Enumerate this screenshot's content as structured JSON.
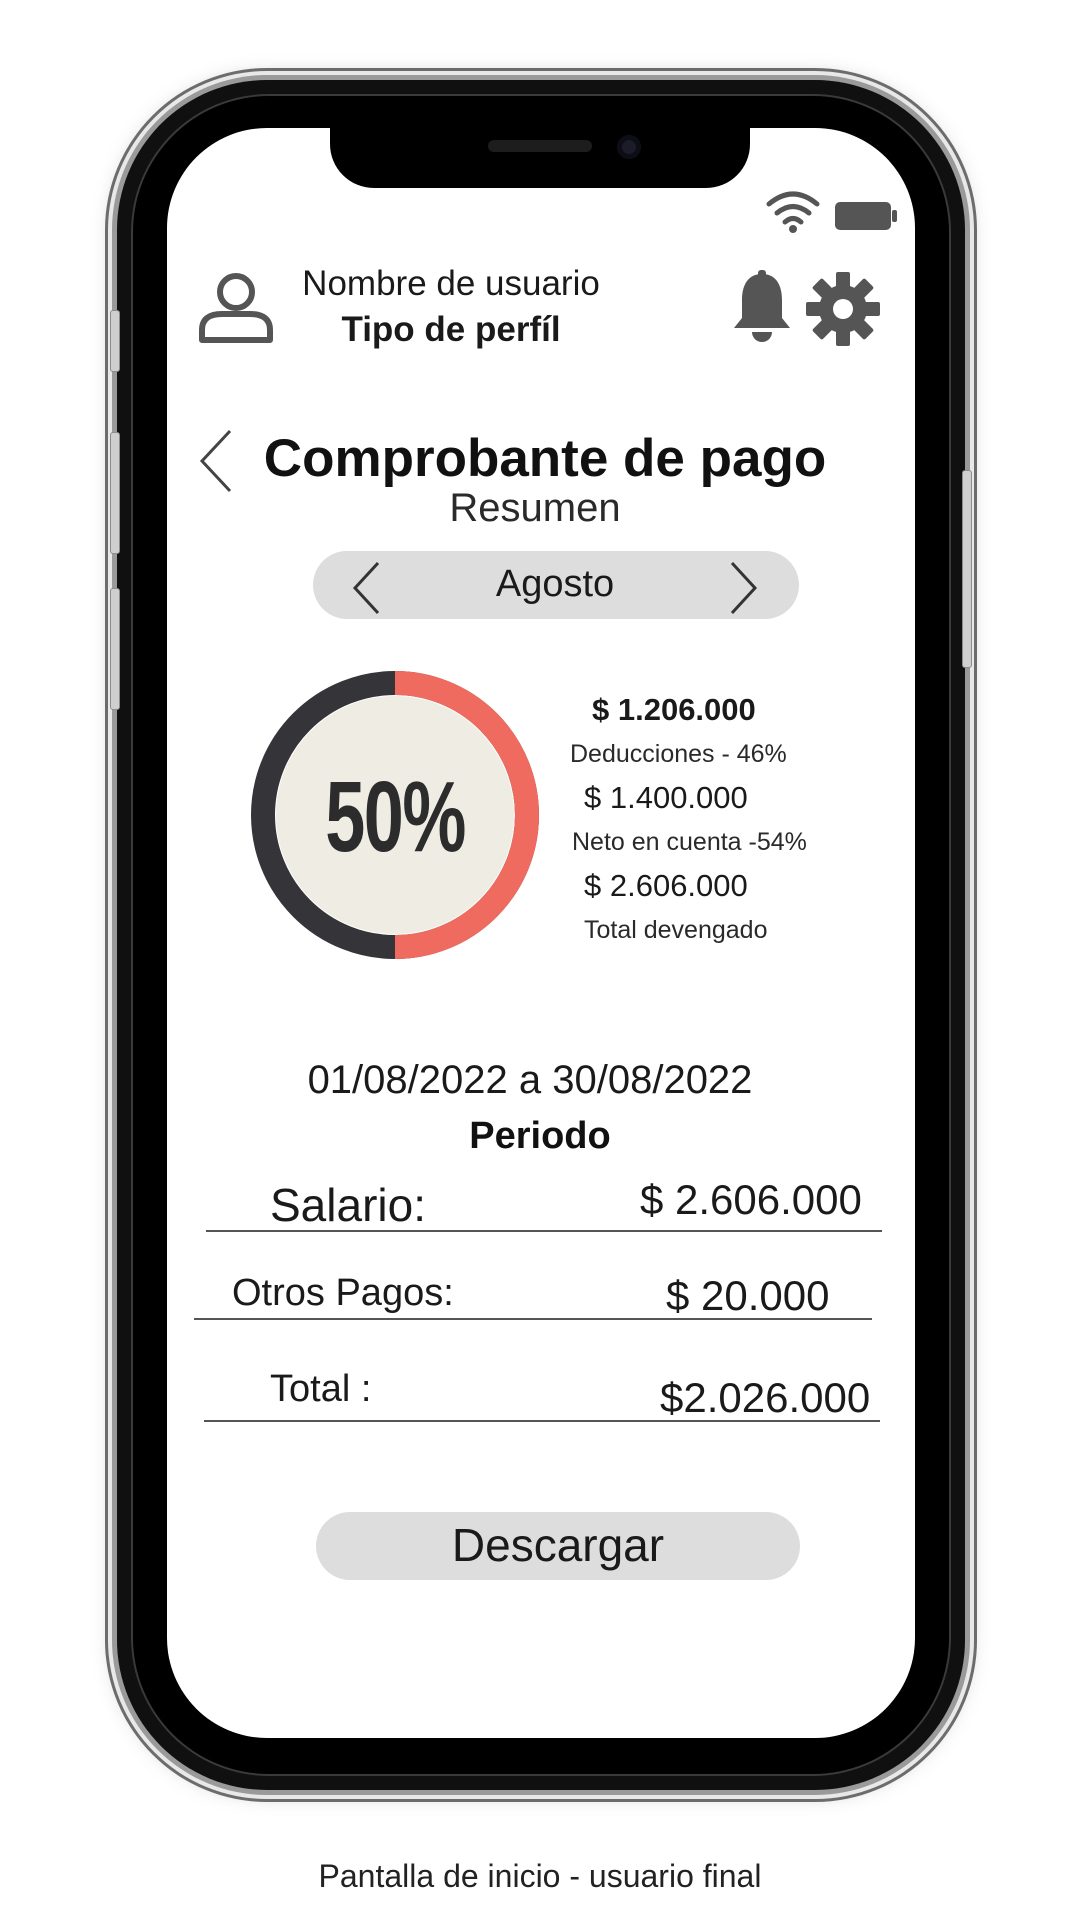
{
  "header": {
    "username": "Nombre de usuario",
    "profile_type": "Tipo de perfíl"
  },
  "page": {
    "title": "Comprobante de pago",
    "subtitle": "Resumen"
  },
  "month_selector": {
    "label": "Agosto"
  },
  "summary": {
    "percent_label": "50%",
    "ring_fraction": 0.5,
    "items": [
      {
        "amount": "$ 1.206.000",
        "label": "Deducciones - 46%"
      },
      {
        "amount": "$ 1.400.000",
        "label": "Neto en cuenta -54%"
      },
      {
        "amount": "$ 2.606.000",
        "label": "Total devengado"
      }
    ]
  },
  "period": {
    "range": "01/08/2022  a 30/08/2022",
    "label": "Periodo"
  },
  "rows": [
    {
      "label": "Salario:",
      "value": "$ 2.606.000"
    },
    {
      "label": "Otros Pagos:",
      "value": "$ 20.000"
    },
    {
      "label": "Total :",
      "value": "$2.026.000"
    }
  ],
  "actions": {
    "download_label": "Descargar"
  },
  "caption": "Pantalla de inicio -  usuario final",
  "colors": {
    "ring_accent": "#f06b5f",
    "ring_dark": "#343439",
    "ring_fill": "#efede3",
    "pill_bg": "#dddddd"
  },
  "icons": {
    "profile": "user-icon",
    "notifications": "bell-icon",
    "settings": "gear-icon",
    "back": "chevron-left-icon",
    "prev_month": "chevron-left-icon",
    "next_month": "chevron-right-icon",
    "wifi": "wifi-icon",
    "battery": "battery-icon"
  }
}
